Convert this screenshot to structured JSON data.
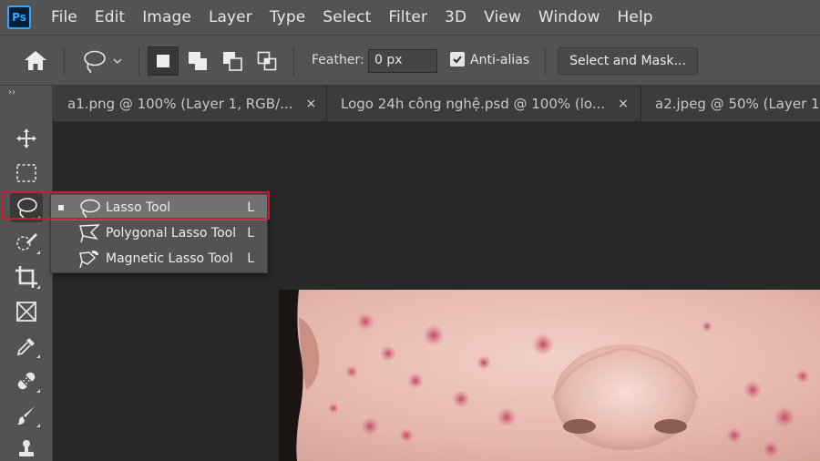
{
  "app": {
    "logo_text": "Ps"
  },
  "menu": [
    "File",
    "Edit",
    "Image",
    "Layer",
    "Type",
    "Select",
    "Filter",
    "3D",
    "View",
    "Window",
    "Help"
  ],
  "options": {
    "feather_label": "Feather:",
    "feather_value": "0 px",
    "antialias_label": "Anti-alias",
    "antialias_checked": true,
    "select_mask_label": "Select and Mask..."
  },
  "tabs": [
    {
      "label": "a1.png @ 100% (Layer 1, RGB/...",
      "close": "×"
    },
    {
      "label": "Logo 24h công nghệ.psd @ 100% (lo...",
      "close": "×"
    },
    {
      "label": "a2.jpeg @ 50% (Layer 1,",
      "close": ""
    }
  ],
  "toolbar": {
    "collapse": "››",
    "tools": [
      "move-tool",
      "rectangular-marquee-tool",
      "lasso-tool",
      "quick-selection-tool",
      "crop-tool",
      "frame-tool",
      "eyedropper-tool",
      "healing-brush-tool",
      "brush-tool",
      "clone-stamp-tool"
    ]
  },
  "flyout": {
    "items": [
      {
        "label": "Lasso Tool",
        "key": "L",
        "icon": "lasso-icon",
        "selected": true
      },
      {
        "label": "Polygonal Lasso Tool",
        "key": "L",
        "icon": "polygonal-lasso-icon",
        "selected": false
      },
      {
        "label": "Magnetic Lasso Tool",
        "key": "L",
        "icon": "magnetic-lasso-icon",
        "selected": false
      }
    ]
  },
  "colors": {
    "chrome": "#535353",
    "canvas_bg": "#282828",
    "highlight_border": "#c5202d",
    "ps_blue": "#31a8ff"
  }
}
